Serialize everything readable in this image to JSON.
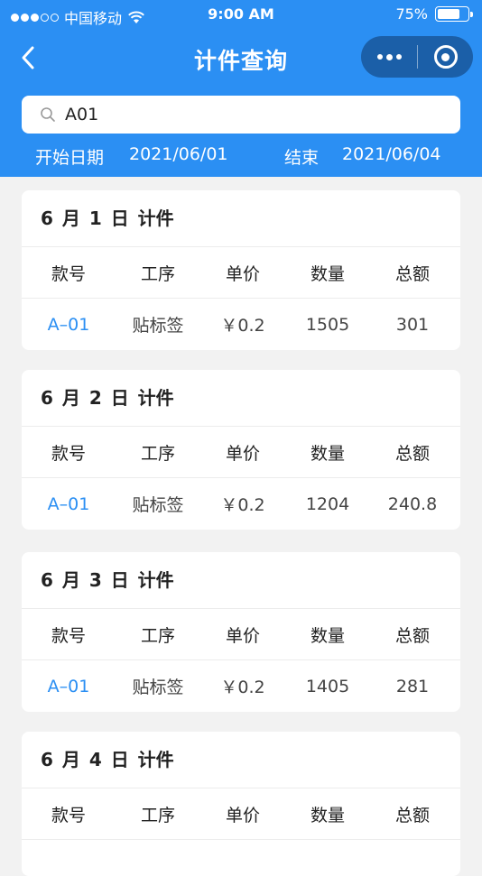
{
  "status_bar": {
    "carrier": "中国移动",
    "time": "9:00 AM",
    "battery": "75%",
    "battery_level": 0.75
  },
  "nav": {
    "title": "计件查询"
  },
  "search": {
    "value": "A01"
  },
  "date_range": {
    "start_label": "开始日期",
    "start_value": "2021/06/01",
    "end_label": "结束",
    "end_value": "2021/06/04"
  },
  "columns": [
    "款号",
    "工序",
    "单价",
    "数量",
    "总额"
  ],
  "cards": [
    {
      "title": "6 月 1 日 计件",
      "rows": [
        {
          "style_no": "A–01",
          "process": "贴标签",
          "unit_price": "￥0.2",
          "quantity": "1505",
          "total": "301"
        }
      ]
    },
    {
      "title": "6 月 2 日 计件",
      "rows": [
        {
          "style_no": "A–01",
          "process": "贴标签",
          "unit_price": "￥0.2",
          "quantity": "1204",
          "total": "240.8"
        }
      ]
    },
    {
      "title": "6 月 3 日 计件",
      "rows": [
        {
          "style_no": "A–01",
          "process": "贴标签",
          "unit_price": "￥0.2",
          "quantity": "1405",
          "total": "281"
        }
      ]
    },
    {
      "title": "6 月 4 日 计件",
      "rows": []
    }
  ],
  "colors": {
    "primary": "#2b8ff3",
    "capsule": "#1b5fa8",
    "background": "#f2f2f2"
  }
}
